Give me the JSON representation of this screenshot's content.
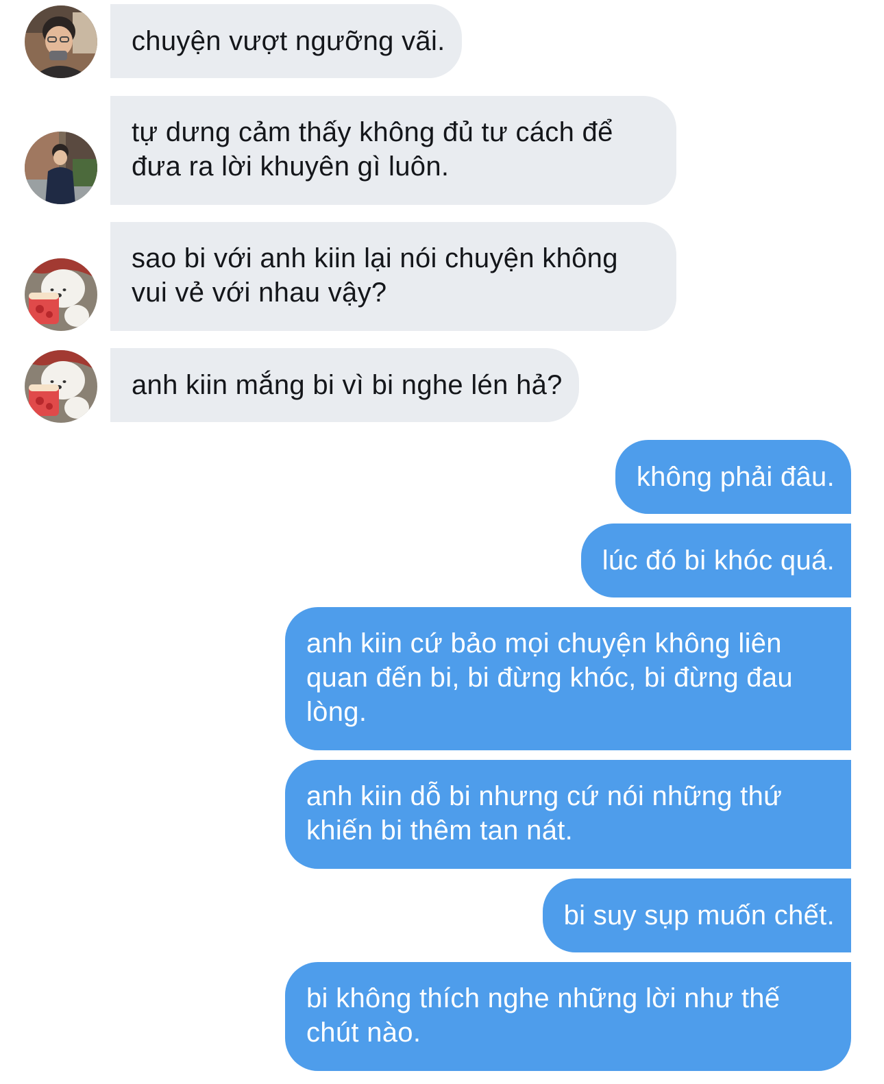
{
  "colors": {
    "incoming_bubble": "#e9ecf0",
    "incoming_text": "#14161a",
    "outgoing_bubble": "#4e9deb",
    "outgoing_text": "#ffffff"
  },
  "messages": [
    {
      "direction": "incoming",
      "avatar": "person-glasses-avatar",
      "text": "chuyện vượt ngưỡng vãi."
    },
    {
      "direction": "incoming",
      "avatar": "person-street-avatar",
      "text": "tự dưng cảm thấy không đủ tư cách để đưa ra lời khuyên gì luôn."
    },
    {
      "direction": "incoming",
      "avatar": "bear-icecream-avatar",
      "text": "sao bi với anh kiin lại nói chuyện không vui vẻ với nhau vậy?"
    },
    {
      "direction": "incoming",
      "avatar": "bear-icecream-avatar",
      "text": "anh kiin mắng bi vì bi nghe lén hả?"
    },
    {
      "direction": "outgoing",
      "text": "không phải đâu."
    },
    {
      "direction": "outgoing",
      "text": "lúc đó bi khóc quá."
    },
    {
      "direction": "outgoing",
      "text": "anh kiin cứ bảo mọi chuyện không liên quan đến bi, bi đừng khóc, bi đừng đau lòng."
    },
    {
      "direction": "outgoing",
      "text": "anh kiin dỗ bi nhưng cứ nói những thứ khiến bi thêm tan nát."
    },
    {
      "direction": "outgoing",
      "text": "bi suy sụp muốn chết."
    },
    {
      "direction": "outgoing",
      "text": "bi không thích nghe những lời như thế chút nào."
    }
  ]
}
